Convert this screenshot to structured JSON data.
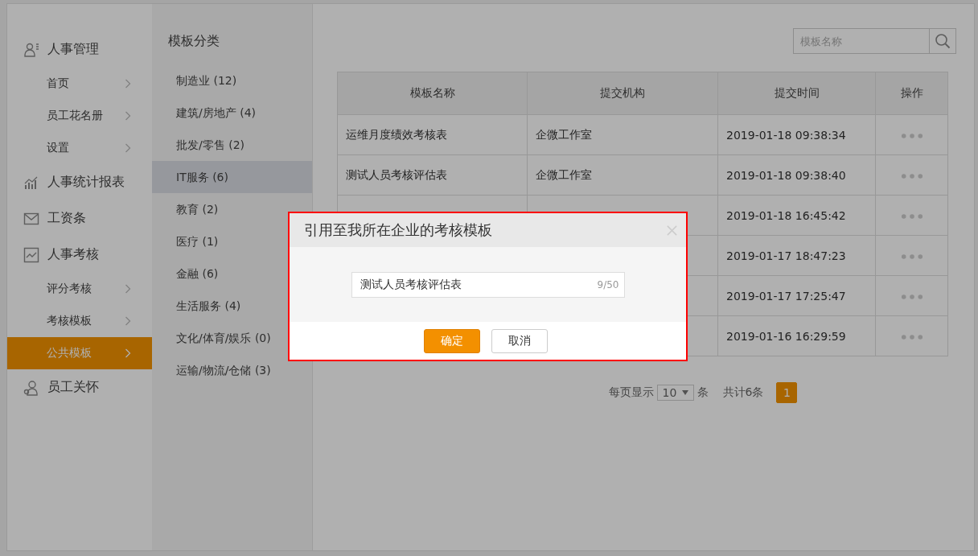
{
  "sidebar": {
    "groups": [
      {
        "label": "人事管理",
        "children": [
          {
            "label": "首页",
            "selected": false
          },
          {
            "label": "员工花名册",
            "selected": false
          },
          {
            "label": "设置",
            "selected": false
          }
        ]
      },
      {
        "label": "人事统计报表"
      },
      {
        "label": "工资条"
      },
      {
        "label": "人事考核",
        "children": [
          {
            "label": "评分考核",
            "selected": false
          },
          {
            "label": "考核模板",
            "selected": false
          },
          {
            "label": "公共模板",
            "selected": true
          }
        ]
      },
      {
        "label": "员工关怀"
      }
    ]
  },
  "categories": {
    "title": "模板分类",
    "items": [
      {
        "label": "制造业 (12)",
        "selected": false
      },
      {
        "label": "建筑/房地产 (4)",
        "selected": false
      },
      {
        "label": "批发/零售 (2)",
        "selected": false
      },
      {
        "label": "IT服务 (6)",
        "selected": true
      },
      {
        "label": "教育 (2)",
        "selected": false
      },
      {
        "label": "医疗 (1)",
        "selected": false
      },
      {
        "label": "金融 (6)",
        "selected": false
      },
      {
        "label": "生活服务 (4)",
        "selected": false
      },
      {
        "label": "文化/体育/娱乐 (0)",
        "selected": false
      },
      {
        "label": "运输/物流/仓储 (3)",
        "selected": false
      }
    ]
  },
  "search": {
    "placeholder": "模板名称"
  },
  "table": {
    "columns": [
      "模板名称",
      "提交机构",
      "提交时间",
      "操作"
    ],
    "rows": [
      {
        "name": "运维月度绩效考核表",
        "org": "企微工作室",
        "time": "2019-01-18 09:38:34"
      },
      {
        "name": "测试人员考核评估表",
        "org": "企微工作室",
        "time": "2019-01-18 09:38:40"
      },
      {
        "time": "2019-01-18 16:45:42"
      },
      {
        "time": "2019-01-17 18:47:23"
      },
      {
        "time": "2019-01-17 17:25:47"
      },
      {
        "time": "2019-01-16 16:29:59"
      }
    ]
  },
  "pagination": {
    "per_page_label": "每页显示",
    "per_page": "10",
    "unit": "条",
    "total": "共计6条",
    "pages": [
      {
        "label": "1",
        "selected": true
      }
    ]
  },
  "dialog": {
    "title": "引用至我所在企业的考核模板",
    "value": "测试人员考核评估表",
    "counter": "9/50",
    "buttons": [
      {
        "label": "确定",
        "kind": "primary"
      },
      {
        "label": "取消",
        "kind": "secondary"
      }
    ]
  }
}
